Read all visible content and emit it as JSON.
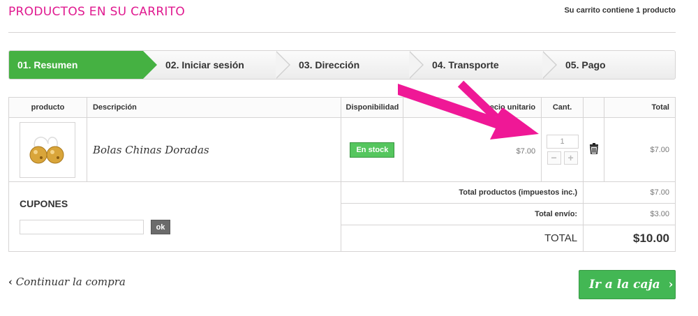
{
  "header": {
    "title": "PRODUCTOS EN SU CARRITO",
    "cart_summary": "Su carrito contiene 1 producto"
  },
  "steps": [
    {
      "label": "01. Resumen",
      "active": true
    },
    {
      "label": "02. Iniciar sesión",
      "active": false
    },
    {
      "label": "03. Dirección",
      "active": false
    },
    {
      "label": "04. Transporte",
      "active": false
    },
    {
      "label": "05. Pago",
      "active": false
    }
  ],
  "table": {
    "headers": {
      "product": "producto",
      "description": "Descripción",
      "availability": "Disponibilidad",
      "unit_price": "Precio unitario",
      "unit_price_visible": "ecio unitario",
      "qty": "Cant.",
      "total": "Total"
    },
    "item": {
      "name": "Bolas Chinas Doradas",
      "availability": "En stock",
      "unit_price": "$7.00",
      "quantity": "1",
      "minus": "−",
      "plus": "+",
      "total": "$7.00"
    },
    "totals": {
      "products_label": "Total productos (impuestos inc.)",
      "products_value": "$7.00",
      "shipping_label": "Total envío:",
      "shipping_value": "$3.00",
      "total_label": "TOTAL",
      "total_value": "$10.00"
    }
  },
  "coupons": {
    "title": "CUPONES",
    "input_value": "",
    "button_label": "ok"
  },
  "footer": {
    "continue_label": "Continuar la compra",
    "checkout_label": "Ir a la caja"
  },
  "colors": {
    "accent_pink": "#e0198f",
    "step_active": "#45b142",
    "checkout_green": "#43b754"
  }
}
